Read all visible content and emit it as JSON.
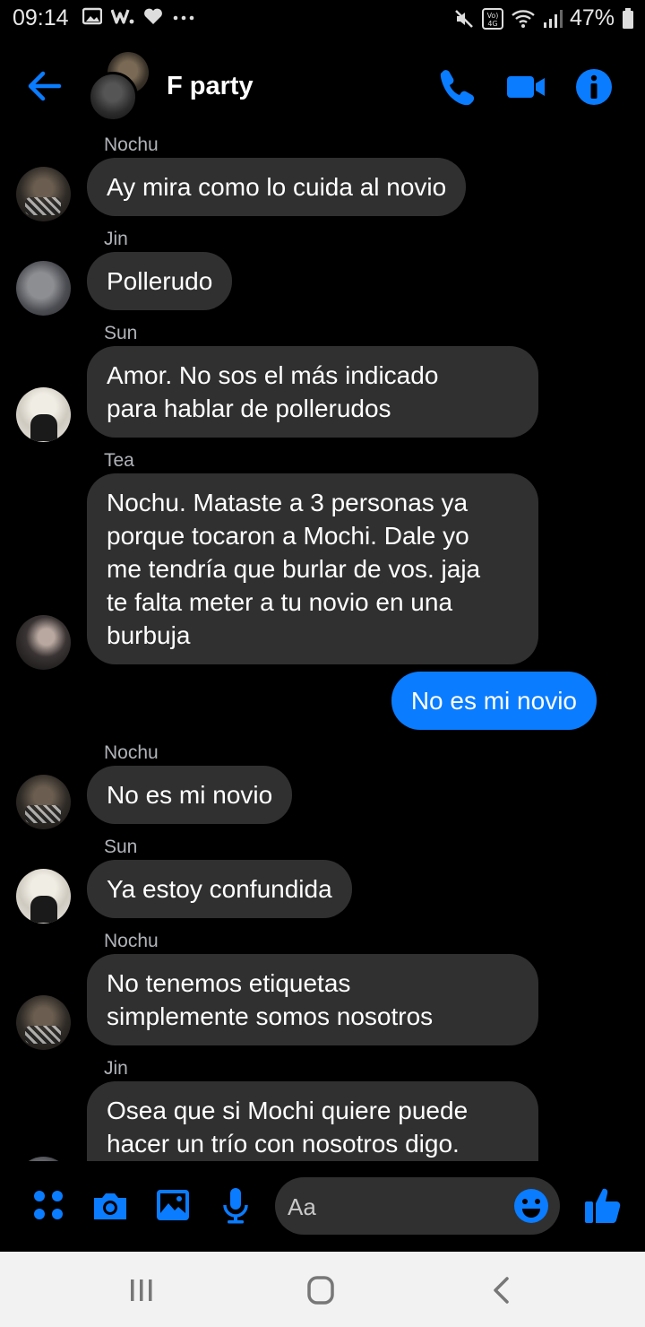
{
  "status_bar": {
    "time": "09:14",
    "battery": "47%",
    "icons": [
      "image-icon",
      "w-icon",
      "heart-icon",
      "more-icon",
      "mute-icon",
      "volte-icon",
      "wifi-icon",
      "signal-icon",
      "battery-icon"
    ]
  },
  "header": {
    "title": "F party",
    "icons": [
      "back-arrow-icon",
      "phone-icon",
      "video-icon",
      "info-icon"
    ],
    "accent": "#0a7cff"
  },
  "messages": [
    {
      "sender": "Nochu",
      "lines": [
        "Ay mira como lo cuida al novio"
      ]
    },
    {
      "sender": "Jin",
      "lines": [
        "Pollerudo"
      ]
    },
    {
      "sender": "Sun",
      "lines": [
        "Amor. No sos el más indicado",
        "para hablar de pollerudos"
      ]
    },
    {
      "sender": "Tea",
      "lines": [
        "Nochu. Mataste a 3 personas ya",
        "porque tocaron a Mochi. Dale yo",
        "me tendría que burlar de vos. jaja",
        "te falta meter a tu novio en una",
        "burbuja"
      ]
    },
    {
      "sender": "",
      "outgoing": true,
      "lines": [
        "No es mi novio"
      ]
    },
    {
      "sender": "Nochu",
      "lines": [
        "No es mi novio"
      ]
    },
    {
      "sender": "Sun",
      "lines": [
        "Ya estoy confundida"
      ]
    },
    {
      "sender": "Nochu",
      "lines": [
        "No tenemos etiquetas",
        "simplemente somos nosotros"
      ]
    },
    {
      "sender": "Jin",
      "lines": [
        "Osea que si Mochi quiere puede",
        "hacer un trío con nosotros digo."
      ]
    }
  ],
  "composer": {
    "placeholder": "Aa",
    "icons": [
      "apps-icon",
      "camera-icon",
      "gallery-icon",
      "mic-icon",
      "emoji-icon",
      "like-icon"
    ]
  },
  "nav_bar": {
    "icons": [
      "recents-icon",
      "home-icon",
      "back-icon"
    ]
  },
  "colors": {
    "background": "#000000",
    "incoming_bubble": "#303030",
    "outgoing_bubble": "#0a7cff",
    "sender_text": "#b0b3b8"
  }
}
